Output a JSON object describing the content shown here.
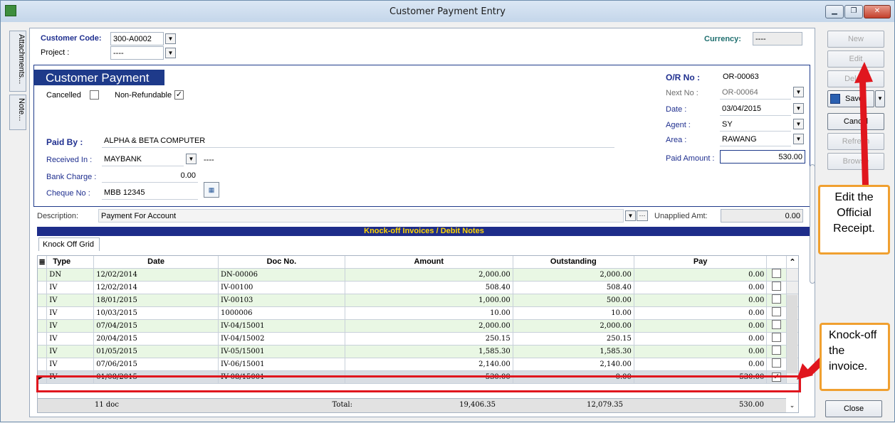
{
  "window": {
    "title": "Customer Payment Entry"
  },
  "side_tabs": [
    "Attachments...",
    "Note..."
  ],
  "header": {
    "customer_code_label": "Customer Code:",
    "customer_code": "300-A0002",
    "project_label": "Project :",
    "project": "----",
    "currency_label": "Currency:",
    "currency": "----"
  },
  "payment": {
    "heading": "Customer Payment",
    "cancelled_label": "Cancelled",
    "cancelled_checked": false,
    "non_refundable_label": "Non-Refundable",
    "non_refundable_checked": true,
    "paid_by_label": "Paid By :",
    "paid_by": "ALPHA & BETA COMPUTER",
    "received_in_label": "Received In :",
    "received_in": "MAYBANK",
    "received_in_extra": "----",
    "bank_charge_label": "Bank Charge :",
    "bank_charge": "0.00",
    "cheque_no_label": "Cheque No :",
    "cheque_no": "MBB 12345",
    "or_no_label": "O/R No :",
    "or_no": "OR-00063",
    "next_no_label": "Next No :",
    "next_no": "OR-00064",
    "date_label": "Date :",
    "date": "03/04/2015",
    "agent_label": "Agent :",
    "agent": "SY",
    "area_label": "Area :",
    "area": "RAWANG",
    "paid_amount_label": "Paid Amount :",
    "paid_amount": "530.00"
  },
  "description": {
    "label": "Description:",
    "value": "Payment For Account",
    "ellipsis": "···",
    "unapplied_label": "Unapplied Amt:",
    "unapplied_value": "0.00"
  },
  "knockoff": {
    "banner": "Knock-off Invoices / Debit Notes",
    "tab": "Knock Off Grid",
    "columns": [
      "Type",
      "Date",
      "Doc No.",
      "Amount",
      "Outstanding",
      "Pay"
    ],
    "rows": [
      {
        "type": "DN",
        "date": "12/02/2014",
        "doc": "DN-00006",
        "amount": "2,000.00",
        "outstanding": "2,000.00",
        "pay": "0.00",
        "checked": false,
        "shade": "g"
      },
      {
        "type": "IV",
        "date": "12/02/2014",
        "doc": "IV-00100",
        "amount": "508.40",
        "outstanding": "508.40",
        "pay": "0.00",
        "checked": false,
        "shade": "w"
      },
      {
        "type": "IV",
        "date": "18/01/2015",
        "doc": "IV-00103",
        "amount": "1,000.00",
        "outstanding": "500.00",
        "pay": "0.00",
        "checked": false,
        "shade": "g"
      },
      {
        "type": "IV",
        "date": "10/03/2015",
        "doc": "1000006",
        "amount": "10.00",
        "outstanding": "10.00",
        "pay": "0.00",
        "checked": false,
        "shade": "w"
      },
      {
        "type": "IV",
        "date": "07/04/2015",
        "doc": "IV-04/15001",
        "amount": "2,000.00",
        "outstanding": "2,000.00",
        "pay": "0.00",
        "checked": false,
        "shade": "g"
      },
      {
        "type": "IV",
        "date": "20/04/2015",
        "doc": "IV-04/15002",
        "amount": "250.15",
        "outstanding": "250.15",
        "pay": "0.00",
        "checked": false,
        "shade": "w"
      },
      {
        "type": "IV",
        "date": "01/05/2015",
        "doc": "IV-05/15001",
        "amount": "1,585.30",
        "outstanding": "1,585.30",
        "pay": "0.00",
        "checked": false,
        "shade": "g"
      },
      {
        "type": "IV",
        "date": "07/06/2015",
        "doc": "IV-06/15001",
        "amount": "2,140.00",
        "outstanding": "2,140.00",
        "pay": "0.00",
        "checked": false,
        "shade": "w"
      },
      {
        "type": "IV",
        "date": "01/08/2015",
        "doc": "IV-08/15001",
        "amount": "530.00",
        "outstanding": "0.00",
        "pay": "530.00",
        "checked": true,
        "shade": "sel"
      }
    ],
    "footer": {
      "count": "11 doc",
      "total_label": "Total:",
      "amount": "19,406.35",
      "outstanding": "12,079.35",
      "pay": "530.00"
    }
  },
  "buttons": {
    "new": "New",
    "edit": "Edit",
    "delete": "Delete",
    "save": "Save",
    "cancel": "Cancel",
    "refresh": "Refresh",
    "browse": "Browse",
    "close": "Close"
  },
  "callouts": {
    "edit": "Edit the Official Receipt.",
    "knockoff": "Knock-off the invoice."
  },
  "colors": {
    "accent_blue": "#1e3a8a",
    "highlight_red": "#e0161e",
    "callout_orange": "#f0a030",
    "row_green": "#e9f7e4"
  }
}
